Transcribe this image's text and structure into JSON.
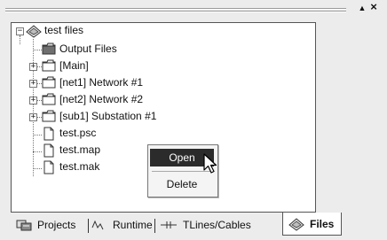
{
  "titlebar": {
    "pin_glyph": "▲",
    "close_glyph": "×"
  },
  "tree": {
    "root": {
      "label": "test files",
      "icon": "project-icon",
      "expander": "−"
    },
    "items": [
      {
        "label": "Output Files",
        "icon": "folder-icon",
        "expander": ""
      },
      {
        "label": "[Main]",
        "icon": "folder-icon",
        "expander": "+"
      },
      {
        "label": "[net1] Network #1",
        "icon": "folder-icon",
        "expander": "+"
      },
      {
        "label": "[net2] Network #2",
        "icon": "folder-icon",
        "expander": "+"
      },
      {
        "label": "[sub1] Substation #1",
        "icon": "folder-icon",
        "expander": "+"
      },
      {
        "label": "test.psc",
        "icon": "file-icon",
        "expander": ""
      },
      {
        "label": "test.map",
        "icon": "file-icon",
        "expander": ""
      },
      {
        "label": "test.mak",
        "icon": "file-icon",
        "expander": ""
      }
    ]
  },
  "context_menu": {
    "items": [
      {
        "label": "Open",
        "highlighted": true
      },
      {
        "label": "Delete",
        "highlighted": false
      }
    ]
  },
  "tabs": [
    {
      "label": "Projects",
      "icon": "projects-icon",
      "active": false
    },
    {
      "label": "Runtime",
      "icon": "waveform-icon",
      "active": false
    },
    {
      "label": "TLines/Cables",
      "icon": "cable-icon",
      "active": false
    },
    {
      "label": "Files",
      "icon": "files-icon",
      "active": true
    }
  ],
  "colors": {
    "background": "#ececec",
    "panel": "#ffffff",
    "highlight": "#2b2b2b"
  }
}
